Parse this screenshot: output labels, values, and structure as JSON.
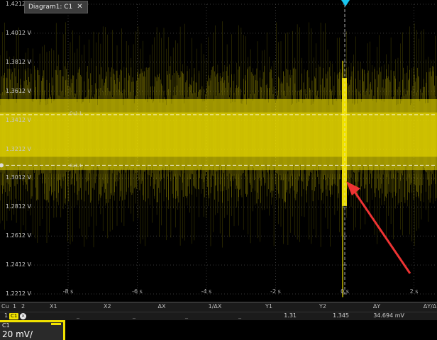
{
  "diagram_tab": {
    "label": "Diagram1: C1",
    "close_glyph": "✕"
  },
  "y_axis": {
    "labels": [
      "1.4212 V",
      "1.4012 V",
      "1.3812 V",
      "1.3612 V",
      "1.3412 V",
      "1.3212 V",
      "1.3012 V",
      "1.2812 V",
      "1.2612 V",
      "1.2412 V",
      "1.2212 V"
    ]
  },
  "x_axis": {
    "labels": [
      "-8 s",
      "-6 s",
      "-4 s",
      "-2 s",
      "0 s",
      "2 s"
    ]
  },
  "cursors": {
    "cursor1_label": "Cu1.1",
    "cursor2_label": "Cu1.1"
  },
  "signal": {
    "color": "#f2e300",
    "center_v": 1.3312,
    "band_half_v": 0.034,
    "spike_time_s": 0
  },
  "measurements": {
    "headers": {
      "cu": "Cu",
      "one": "1",
      "two": "2",
      "x1": "X1",
      "x2": "X2",
      "dx": "ΔX",
      "inv_dx": "1/ΔX",
      "y1": "Y1",
      "y2": "Y2",
      "dy": "ΔY",
      "dydx": "ΔY/Δ"
    },
    "row": {
      "index": "1",
      "channel": "C1",
      "x1": "",
      "x2": "",
      "dx": "",
      "inv_dx": "",
      "y1": "1.31",
      "y2": "1.345",
      "dy": "34.694 mV"
    }
  },
  "channel_panel": {
    "name": "C1",
    "scale": "20 mV/"
  },
  "arrow_color": "#ee3333"
}
